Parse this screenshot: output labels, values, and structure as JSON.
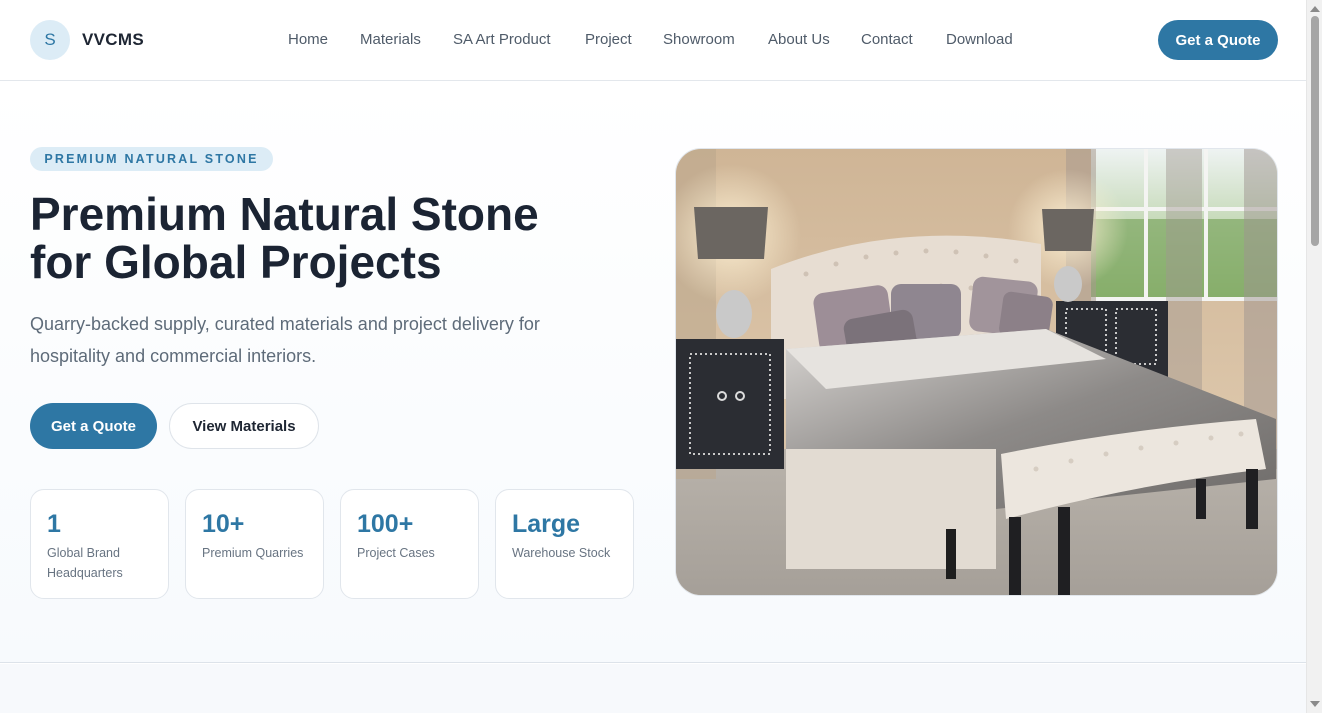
{
  "header": {
    "logo_letter": "S",
    "brand": "VVCMS",
    "nav": [
      {
        "label": "Home"
      },
      {
        "label": "Materials"
      },
      {
        "label": "SA Art Product"
      },
      {
        "label": "Project"
      },
      {
        "label": "Showroom"
      },
      {
        "label": "About Us"
      },
      {
        "label": "Contact"
      },
      {
        "label": "Download"
      }
    ],
    "cta_label": "Get a Quote"
  },
  "hero": {
    "eyebrow": "PREMIUM NATURAL STONE",
    "headline_line1": "Premium Natural Stone",
    "headline_line2": "for Global Projects",
    "subtitle_line1": "Quarry-backed supply, curated materials and project delivery for",
    "subtitle_line2": "hospitality and commercial interiors.",
    "primary_button": "Get a Quote",
    "secondary_button": "View Materials",
    "stats": [
      {
        "value": "1",
        "label_line1": "Global Brand",
        "label_line2": "Headquarters"
      },
      {
        "value": "10+",
        "label_line1": "Premium Quarries",
        "label_line2": ""
      },
      {
        "value": "100+",
        "label_line1": "Project Cases",
        "label_line2": ""
      },
      {
        "value": "Large",
        "label_line1": "Warehouse Stock",
        "label_line2": ""
      }
    ],
    "image_subject": "bedroom-interior-photo"
  },
  "colors": {
    "accent": "#2e77a4",
    "accent_light": "#dcecf6",
    "heading": "#1b2433",
    "muted": "#5e6b79"
  }
}
